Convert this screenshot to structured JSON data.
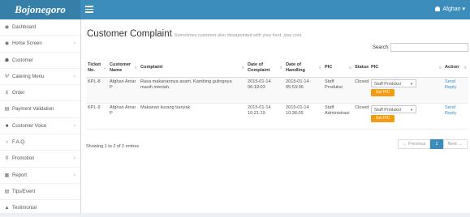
{
  "app": {
    "logo": "Bojonegoro",
    "user": "Afghan"
  },
  "colors": {
    "topbar": "#3c8dbc",
    "logo_bg": "#367fa9",
    "accent_button": "#f39c12",
    "link": "#3c8dbc"
  },
  "sidebar": {
    "items": [
      {
        "label": "Dashboard",
        "icon": "dashboard-icon",
        "glyph": "◉",
        "arrow": ""
      },
      {
        "label": "Home Screen",
        "icon": "home-screen-icon",
        "glyph": "◉",
        "arrow": "‹"
      },
      {
        "label": "Customer",
        "icon": "users-icon",
        "glyph": "☗",
        "arrow": ""
      },
      {
        "label": "Catering Menu",
        "icon": "cutlery-icon",
        "glyph": "Ψ",
        "arrow": "‹"
      },
      {
        "label": "Order",
        "icon": "cart-icon",
        "glyph": "⊻",
        "arrow": ""
      },
      {
        "label": "Payment Validation",
        "icon": "payment-icon",
        "glyph": "▤",
        "arrow": ""
      },
      {
        "label": "Customer Voice",
        "icon": "voice-icon",
        "glyph": "■",
        "arrow": "‹"
      },
      {
        "label": "F.A.Q.",
        "icon": "faq-icon",
        "glyph": "○",
        "arrow": ""
      },
      {
        "label": "Promotion",
        "icon": "promotion-icon",
        "glyph": "⚲",
        "arrow": "‹"
      },
      {
        "label": "Report",
        "icon": "report-icon",
        "glyph": "▦",
        "arrow": "‹"
      },
      {
        "label": "Tips/Event",
        "icon": "tips-icon",
        "glyph": "▤",
        "arrow": ""
      },
      {
        "label": "Testimonial",
        "icon": "thumbs-up-icon",
        "glyph": "▲",
        "arrow": ""
      }
    ]
  },
  "page": {
    "title": "Customer Complaint",
    "subtitle": "Sometimes customer also dissapointed with your food, stay cool.",
    "search_label": "Search:",
    "search_value": ""
  },
  "table": {
    "columns": [
      "Ticket No.",
      "Customer Name",
      "Complaint",
      "Date of Complaint",
      "Date of Handling",
      "PIC",
      "Status",
      "PIC",
      "Action"
    ],
    "rows": [
      {
        "ticket": "KPL-8",
        "customer": "Afghan Amar P",
        "complaint": "Rasa makanannya asam. Kambing gulingnya masih mentah.",
        "date_complaint": "2015-01-14 06:19:03",
        "date_handling": "2015-01-14 05:53:36",
        "pic": "Staff Produksi",
        "status": "Closed",
        "pic_select": "Staff Produksi",
        "set_pic": "Set PIC",
        "action_send": "Send",
        "action_reply": "Reply"
      },
      {
        "ticket": "KPL-9",
        "customer": "Afghan Amar P",
        "complaint": "Makanan kurang banyak",
        "date_complaint": "2015-01-14 10:21:19",
        "date_handling": "2015-01-14 10:36:05",
        "pic": "Staff Administrasi",
        "status": "Closed",
        "pic_select": "Staff Produksi",
        "set_pic": "Set PIC",
        "action_send": "Send",
        "action_reply": "Reply"
      }
    ]
  },
  "footer": {
    "info": "Showing 1 to 2 of 2 entries",
    "prev": "← Previous",
    "page": "1",
    "next": "Next →"
  }
}
